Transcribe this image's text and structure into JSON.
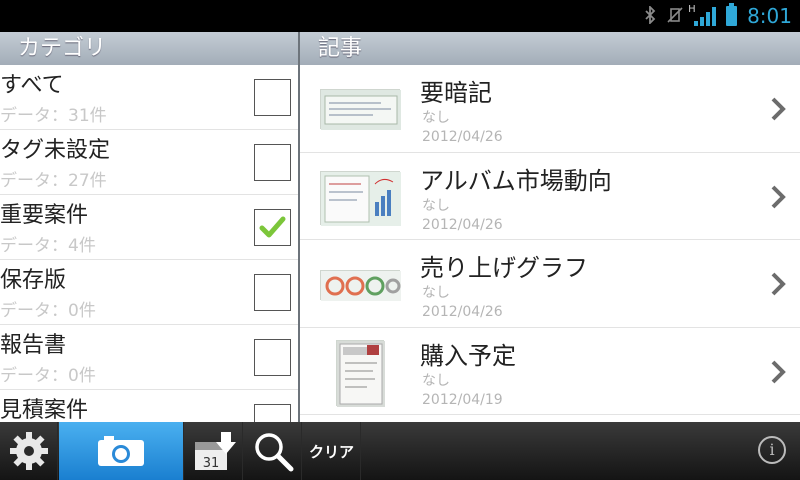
{
  "status_bar": {
    "time": "8:01",
    "signal_type": "H",
    "icons": [
      "bluetooth-icon",
      "vibrate-off-icon",
      "signal-icon",
      "battery-icon"
    ],
    "accent_color": "#2fa8d8"
  },
  "left_panel": {
    "header": "カテゴリ",
    "categories": [
      {
        "name": "すべて",
        "count": "データ：31件",
        "checked": false
      },
      {
        "name": "タグ未設定",
        "count": "データ：27件",
        "checked": false
      },
      {
        "name": "重要案件",
        "count": "データ：4件",
        "checked": true
      },
      {
        "name": "保存版",
        "count": "データ：0件",
        "checked": false
      },
      {
        "name": "報告書",
        "count": "データ：0件",
        "checked": false
      },
      {
        "name": "見積案件",
        "count": "",
        "checked": false
      }
    ]
  },
  "right_panel": {
    "header": "記事",
    "articles": [
      {
        "title": "要暗記",
        "tag": "なし",
        "date": "2012/04/26"
      },
      {
        "title": "アルバム市場動向",
        "tag": "なし",
        "date": "2012/04/26"
      },
      {
        "title": "売り上げグラフ",
        "tag": "なし",
        "date": "2012/04/26"
      },
      {
        "title": "購入予定",
        "tag": "なし",
        "date": "2012/04/19"
      }
    ]
  },
  "toolbar": {
    "buttons": [
      "gear-icon",
      "camera-icon",
      "calendar-download-icon",
      "search-icon"
    ],
    "calendar_day": "31",
    "clear_label": "クリア",
    "info_label": "i",
    "active_color": "#2a90e0"
  }
}
